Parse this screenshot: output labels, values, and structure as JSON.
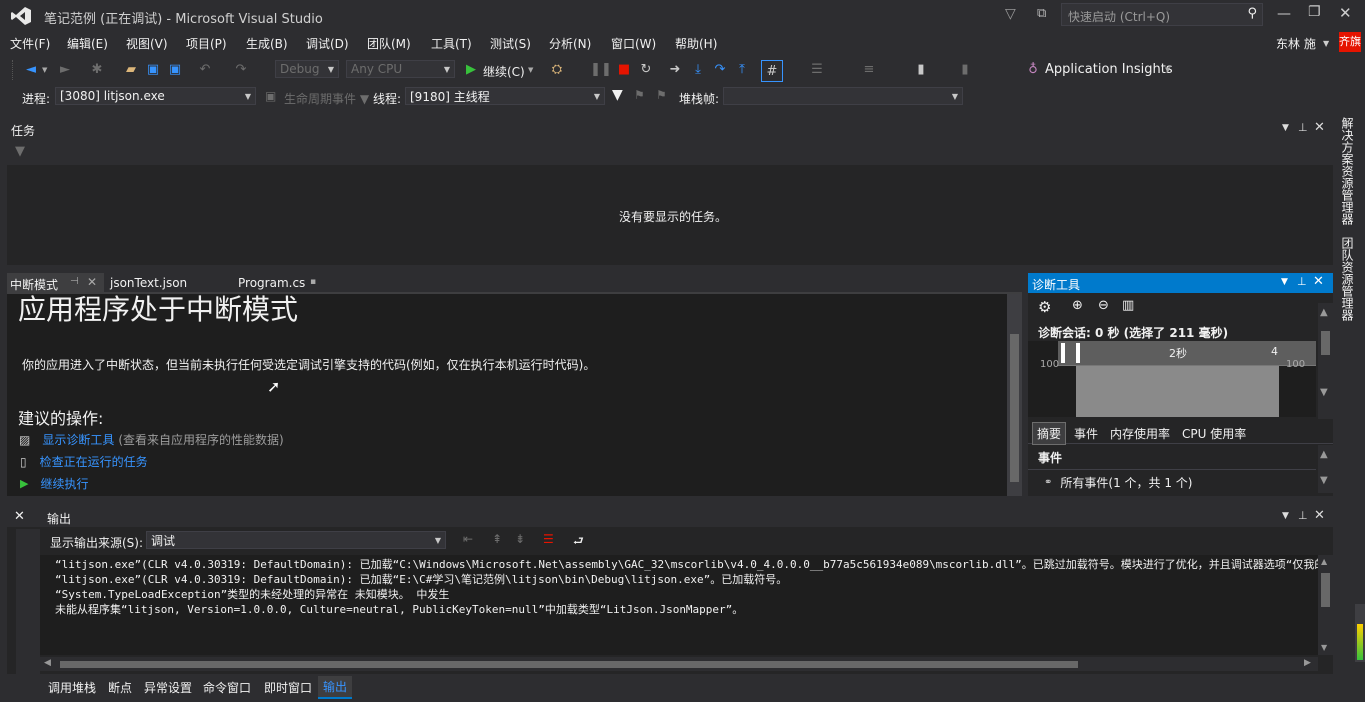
{
  "window": {
    "title": "笔记范例 (正在调试) - Microsoft Visual Studio",
    "quick_launch_placeholder": "快速启动 (Ctrl+Q)",
    "user": "东林 施",
    "user_badge": "齐旗"
  },
  "menu": [
    "文件(F)",
    "编辑(E)",
    "视图(V)",
    "项目(P)",
    "生成(B)",
    "调试(D)",
    "团队(M)",
    "工具(T)",
    "测试(S)",
    "分析(N)",
    "窗口(W)",
    "帮助(H)"
  ],
  "toolbar": {
    "config": "Debug",
    "platform": "Any CPU",
    "continue_label": "继续(C)",
    "app_insights": "Application Insights"
  },
  "debug_location": {
    "process_label": "进程:",
    "process_value": "[3080] litjson.exe",
    "lifecycle_label": "生命周期事件",
    "thread_label": "线程:",
    "thread_value": "[9180] 主线程",
    "stack_label": "堆栈帧:"
  },
  "task_panel": {
    "title": "任务",
    "empty_message": "没有要显示的任务。"
  },
  "editor_tabs": [
    "中断模式",
    "jsonText.json",
    "Program.cs"
  ],
  "break_mode": {
    "heading": "应用程序处于中断模式",
    "description": "你的应用进入了中断状态，但当前未执行任何受选定调试引擎支持的代码(例如，仅在执行本机运行时代码)。",
    "actions_heading": "建议的操作:",
    "actions": [
      {
        "link": "显示诊断工具",
        "note": "(查看来自应用程序的性能数据)"
      },
      {
        "link": "检查正在运行的任务",
        "note": ""
      },
      {
        "link": "继续执行",
        "note": ""
      }
    ]
  },
  "diagnostics": {
    "title": "诊断工具",
    "session": "诊断会话: 0 秒 (选择了 211 毫秒)",
    "timeline_tick_2s": "2秒",
    "timeline_tick_4": "4",
    "axis_left": "100",
    "axis_right": "100",
    "tabs": [
      "摘要",
      "事件",
      "内存使用率",
      "CPU 使用率"
    ],
    "events_heading": "事件",
    "events_item": "所有事件(1 个，共 1 个)"
  },
  "output": {
    "title": "输出",
    "source_label": "显示输出来源(S):",
    "source_value": "调试",
    "lines": [
      "“litjson.exe”(CLR v4.0.30319: DefaultDomain): 已加载“C:\\Windows\\Microsoft.Net\\assembly\\GAC_32\\mscorlib\\v4.0_4.0.0.0__b77a5c561934e089\\mscorlib.dll”。已跳过加载符号。模块进行了优化，并且调试器选项“仅我的代码",
      "“litjson.exe”(CLR v4.0.30319: DefaultDomain): 已加载“E:\\C#学习\\笔记范例\\litjson\\bin\\Debug\\litjson.exe”。已加载符号。",
      "“System.TypeLoadException”类型的未经处理的异常在 未知模块。 中发生",
      "未能从程序集“litjson, Version=1.0.0.0, Culture=neutral, PublicKeyToken=null”中加载类型“LitJson.JsonMapper”。"
    ]
  },
  "bottom_tabs": [
    "调用堆栈",
    "断点",
    "异常设置",
    "命令窗口",
    "即时窗口",
    "输出"
  ],
  "right_rail": [
    "解决方案资源管理器",
    "团队资源管理器"
  ],
  "colors": {
    "accent": "#007acc",
    "link": "#3794ff",
    "background": "#2d2d30",
    "panel": "#252526"
  }
}
